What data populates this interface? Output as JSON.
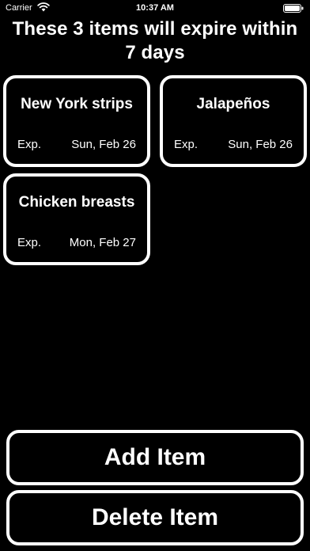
{
  "status_bar": {
    "carrier": "Carrier",
    "time": "10:37 AM",
    "wifi_icon": "wifi-icon",
    "battery_icon": "battery-icon"
  },
  "header": {
    "line1": "These 3 items will expire within",
    "line2": "7 days"
  },
  "items": [
    {
      "name": "New York strips",
      "exp_label": "Exp.",
      "exp_date": "Sun, Feb 26"
    },
    {
      "name": "Jalapeños",
      "exp_label": "Exp.",
      "exp_date": "Sun, Feb 26"
    },
    {
      "name": "Chicken breasts",
      "exp_label": "Exp.",
      "exp_date": "Mon, Feb 27"
    }
  ],
  "actions": {
    "add_label": "Add Item",
    "delete_label": "Delete Item"
  },
  "colors": {
    "background": "#000000",
    "foreground": "#ffffff"
  }
}
